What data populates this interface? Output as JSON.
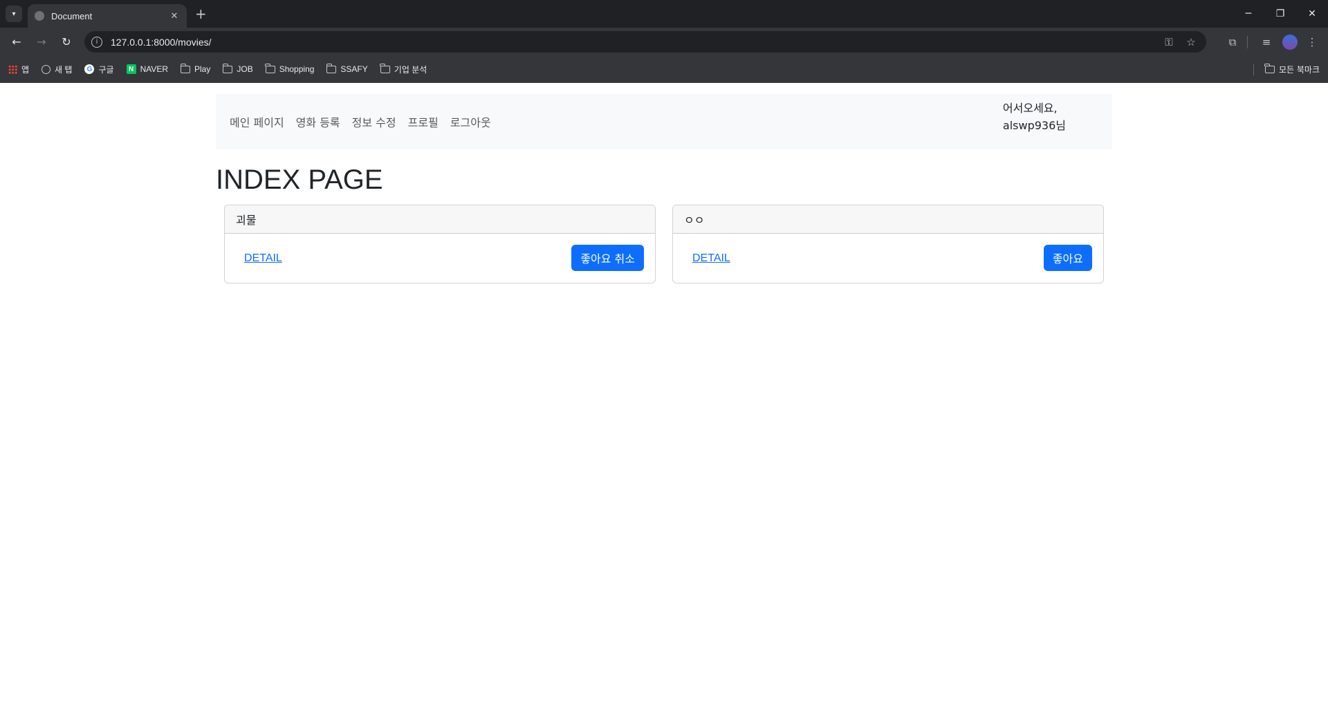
{
  "browser": {
    "tab_title": "Document",
    "url": "127.0.0.1:8000/movies/",
    "bookmarks": [
      {
        "label": "앱",
        "icon": "apps-icon"
      },
      {
        "label": "새 탭",
        "icon": "globe-icon"
      },
      {
        "label": "구글",
        "icon": "google-icon"
      },
      {
        "label": "NAVER",
        "icon": "naver-icon"
      },
      {
        "label": "Play",
        "icon": "folder-icon"
      },
      {
        "label": "JOB",
        "icon": "folder-icon"
      },
      {
        "label": "Shopping",
        "icon": "folder-icon"
      },
      {
        "label": "SSAFY",
        "icon": "folder-icon"
      },
      {
        "label": "기업 분석",
        "icon": "folder-icon"
      }
    ],
    "all_bookmarks": "모든 북마크"
  },
  "navbar": {
    "links": [
      "메인 페이지",
      "영화 등록",
      "정보 수정",
      "프로필",
      "로그아웃"
    ],
    "welcome_line1": "어서오세요,",
    "welcome_line2": "alswp936님"
  },
  "main": {
    "title": "INDEX PAGE",
    "cards": [
      {
        "title": "괴물",
        "detail_label": "DETAIL",
        "like_label": "좋아요 취소"
      },
      {
        "title": "ㅇㅇ",
        "detail_label": "DETAIL",
        "like_label": "좋아요"
      }
    ]
  },
  "colors": {
    "primary": "#0d6efd",
    "navbar_bg": "#f8f9fa",
    "chrome_dark": "#202124",
    "chrome_toolbar": "#35363a"
  }
}
